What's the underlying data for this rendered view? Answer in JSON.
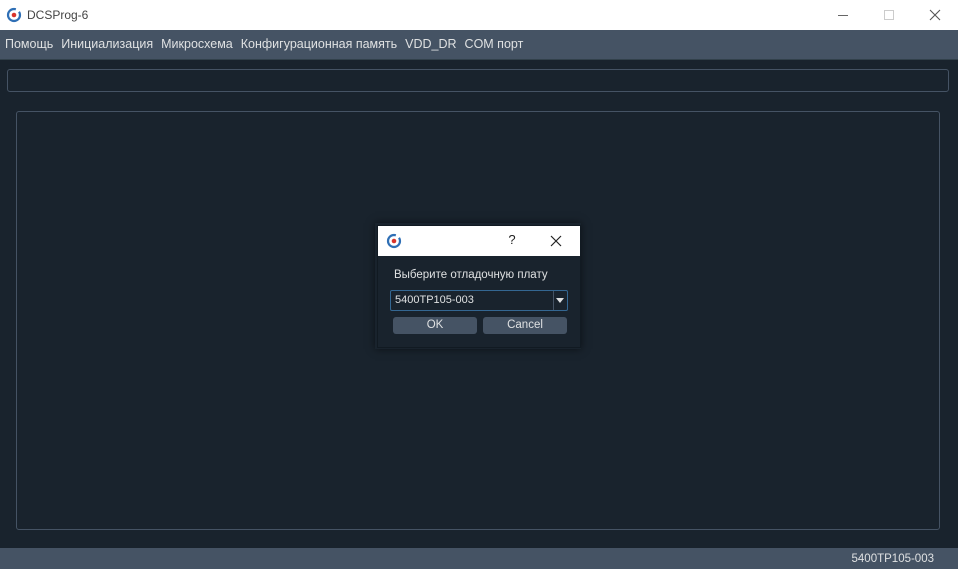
{
  "window": {
    "title": "DCSProg-6",
    "icons": {
      "logo": "app-logo-icon",
      "minimize": "minimize-icon",
      "maximize": "maximize-icon",
      "close": "close-icon"
    }
  },
  "menu": {
    "items": [
      "Помощь",
      "Инициализация",
      "Микросхема",
      "Конфигурационная память",
      "VDD_DR",
      "COM порт"
    ]
  },
  "statusbar": {
    "text": "5400ТР105-003"
  },
  "dialog": {
    "help_label": "?",
    "prompt": "Выберите отладочную плату",
    "combo_value": "5400ТР105-003",
    "ok_label": "OK",
    "cancel_label": "Cancel"
  },
  "colors": {
    "background": "#19232d",
    "menubar": "#455364",
    "border": "#455364",
    "focus": "#346792",
    "text": "#dfe1e2",
    "logo_blue": "#2f6fb5",
    "logo_red": "#d9342b"
  }
}
